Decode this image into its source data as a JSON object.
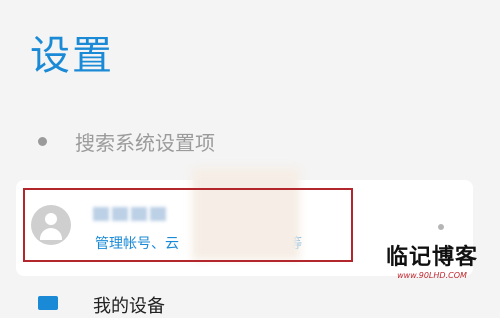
{
  "header": {
    "title": "设置"
  },
  "search": {
    "label": "搜索系统设置项"
  },
  "account": {
    "subtitle_left": "管理帐号、云",
    "subtitle_right": "息等"
  },
  "next_item": {
    "label": "我的设备"
  },
  "watermark": {
    "main": "临记博客",
    "url": "www.90LHD.COM"
  },
  "colors": {
    "accent": "#1b8ad6",
    "highlight": "#b3262c"
  }
}
